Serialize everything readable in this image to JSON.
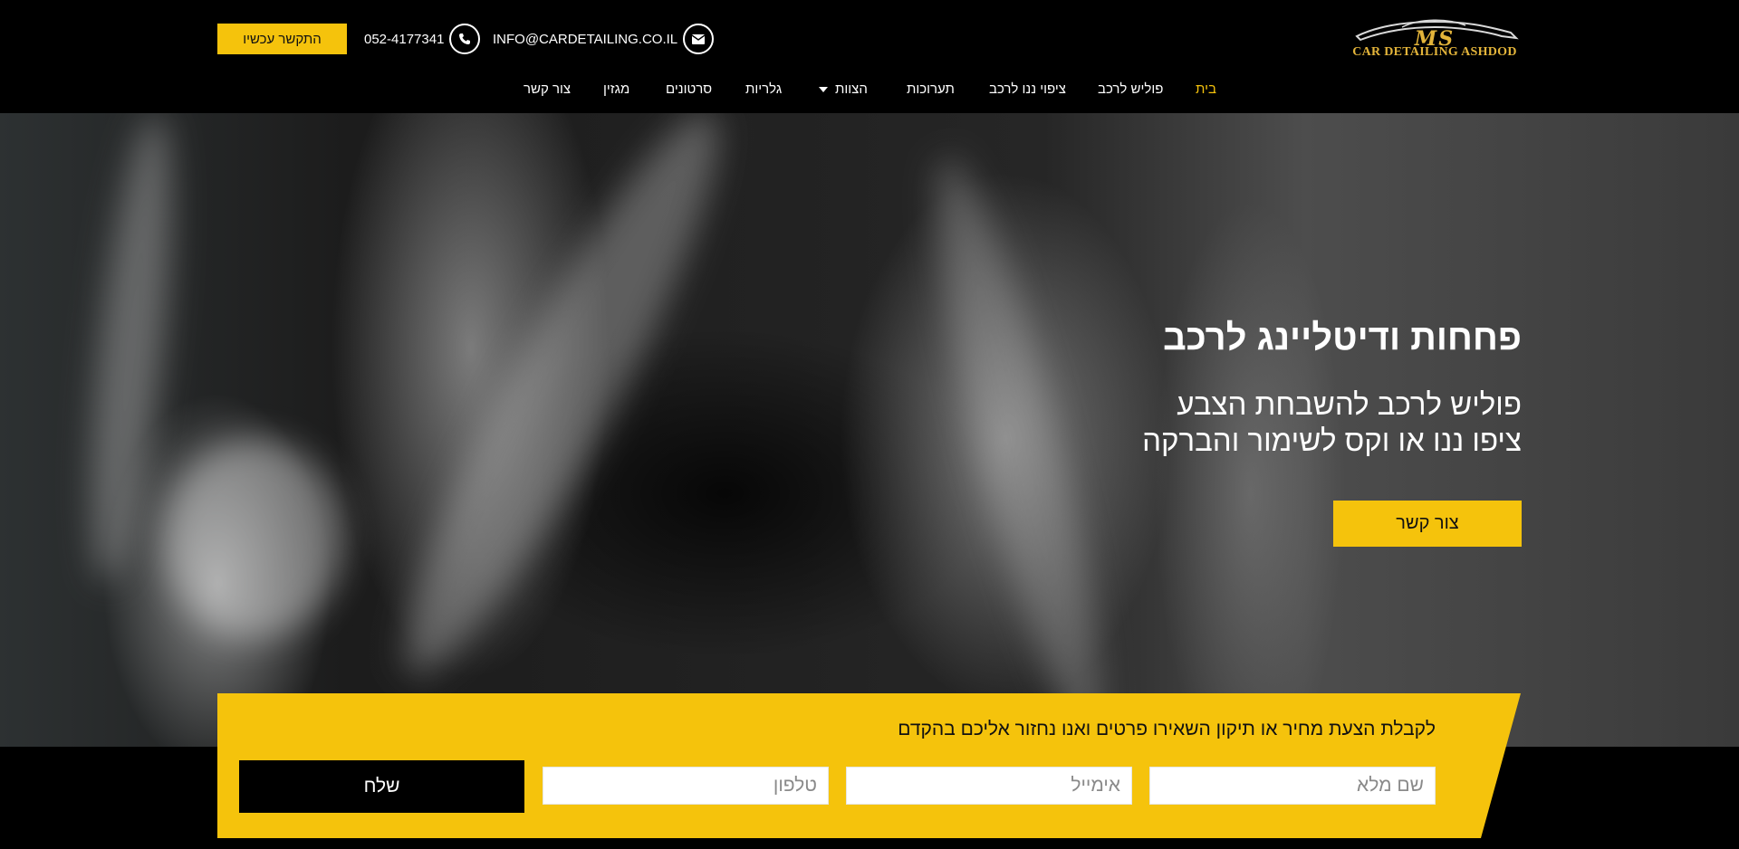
{
  "header": {
    "logo": {
      "monogram": "MS",
      "text": "CAR DETAILING ASHDOD"
    },
    "email": "INFO@CARDETAILING.CO.IL",
    "phone": "052-4177341",
    "call_button": "התקשר עכשיו",
    "icons": {
      "email": "envelope-icon",
      "phone": "phone-icon"
    }
  },
  "nav": {
    "items": [
      {
        "label": "בית",
        "active": true
      },
      {
        "label": "פוליש לרכב"
      },
      {
        "label": "ציפוי ננו לרכב"
      },
      {
        "label": "תערוכות"
      },
      {
        "label": "הצוות",
        "dropdown": true
      },
      {
        "label": "גלריות"
      },
      {
        "label": "סרטונים"
      },
      {
        "label": "מגזין"
      },
      {
        "label": "צור קשר"
      }
    ]
  },
  "hero": {
    "title": "פחחות ודיטליינג לרכב",
    "subtitle_line1": "פוליש לרכב להשבחת הצבע",
    "subtitle_line2": "ציפו ננו או וקס לשימור והברקה",
    "cta": "צור קשר"
  },
  "quote_form": {
    "title": "לקבלת הצעת מחיר או תיקון השאירו פרטים ואנו נחזור אליכם בהקדם",
    "name_placeholder": "שם מלא",
    "email_placeholder": "אימייל",
    "phone_placeholder": "טלפון",
    "submit": "שלח"
  },
  "colors": {
    "accent": "#f5c30c",
    "background": "#000000",
    "logo_gold": "#e3b43a"
  }
}
